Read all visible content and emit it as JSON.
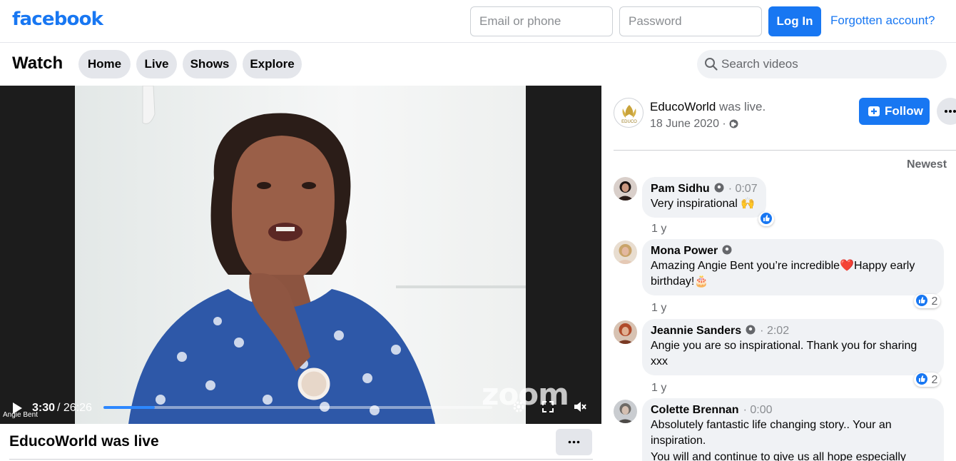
{
  "header": {
    "logo": "facebook",
    "email_placeholder": "Email or phone",
    "password_placeholder": "Password",
    "login_label": "Log In",
    "forgot_label": "Forgotten account?"
  },
  "watch_nav": {
    "title": "Watch",
    "tabs": [
      {
        "label": "Home"
      },
      {
        "label": "Live"
      },
      {
        "label": "Shows"
      },
      {
        "label": "Explore"
      }
    ],
    "search_placeholder": "Search videos"
  },
  "video": {
    "watermark": "zoom",
    "speaker_name": "Angie Bent",
    "current_time": "3:30",
    "duration_text": "/ 26:26",
    "progress_fraction": 0.132,
    "accent": "#2d88ff"
  },
  "post": {
    "title": "EducoWorld was live"
  },
  "sidebar": {
    "page_avatar_text": "EDUCO",
    "page_name": "EducoWorld",
    "status_text": " was live.",
    "date": "18 June 2020 ·",
    "follow_label": "Follow",
    "sort_label": "Newest",
    "comments": [
      {
        "author": "Pam Sidhu",
        "timestamp": "· 0:07",
        "text": "Very inspirational 🙌",
        "age": "1 y",
        "reaction_count": ""
      },
      {
        "author": "Mona Power",
        "timestamp": "",
        "text": "Amazing Angie Bent you’re incredible❤️Happy early birthday!🎂",
        "age": "1 y",
        "reaction_count": "2"
      },
      {
        "author": "Jeannie Sanders",
        "timestamp": "· 2:02",
        "text": "Angie you are so inspirational. Thank you for sharing xxx",
        "age": "1 y",
        "reaction_count": "2"
      },
      {
        "author": "Colette Brennan",
        "timestamp": "· 0:00",
        "text": "Absolutely fantastic life changing story.. Your an inspiration.",
        "text2": "You will and continue to give us all hope especially",
        "age": "",
        "reaction_count": ""
      }
    ]
  },
  "colors": {
    "brand": "#1877f2",
    "tab_bg": "#e4e6eb",
    "bubble_bg": "#f0f2f5"
  }
}
